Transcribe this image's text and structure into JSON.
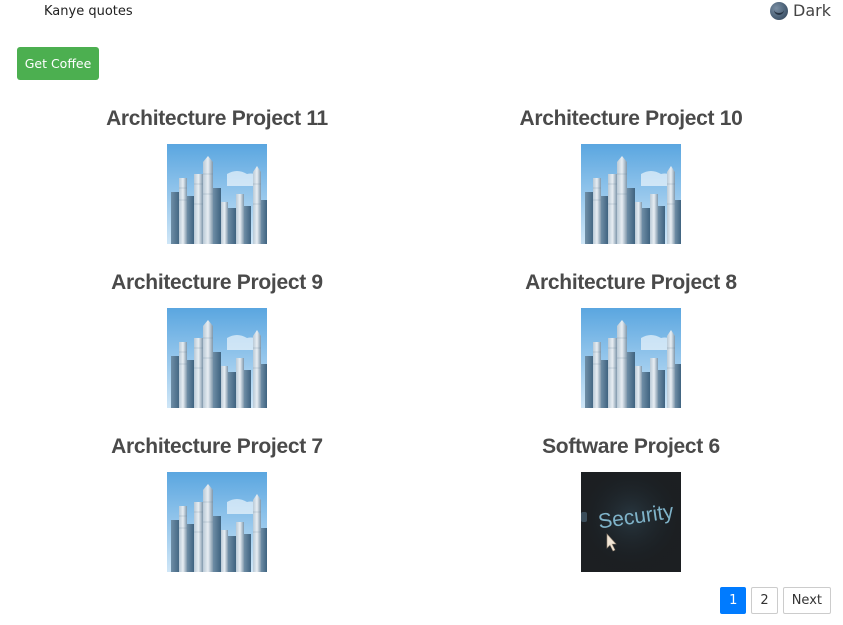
{
  "nav": {
    "link_label": "Kanye quotes"
  },
  "theme_toggle": {
    "icon": "moon-icon",
    "label": "Dark"
  },
  "coffee_button": {
    "label": "Get Coffee",
    "color": "#4caf50"
  },
  "projects": [
    {
      "title": "Architecture Project 11",
      "image": "city-skyline"
    },
    {
      "title": "Architecture Project 10",
      "image": "city-skyline"
    },
    {
      "title": "Architecture Project 9",
      "image": "city-skyline"
    },
    {
      "title": "Architecture Project 8",
      "image": "city-skyline"
    },
    {
      "title": "Architecture Project 7",
      "image": "city-skyline"
    },
    {
      "title": "Software Project 6",
      "image": "security-screen"
    }
  ],
  "pagination": {
    "pages": [
      "1",
      "2"
    ],
    "current": "1",
    "next_label": "Next",
    "active_color": "#007bff"
  }
}
